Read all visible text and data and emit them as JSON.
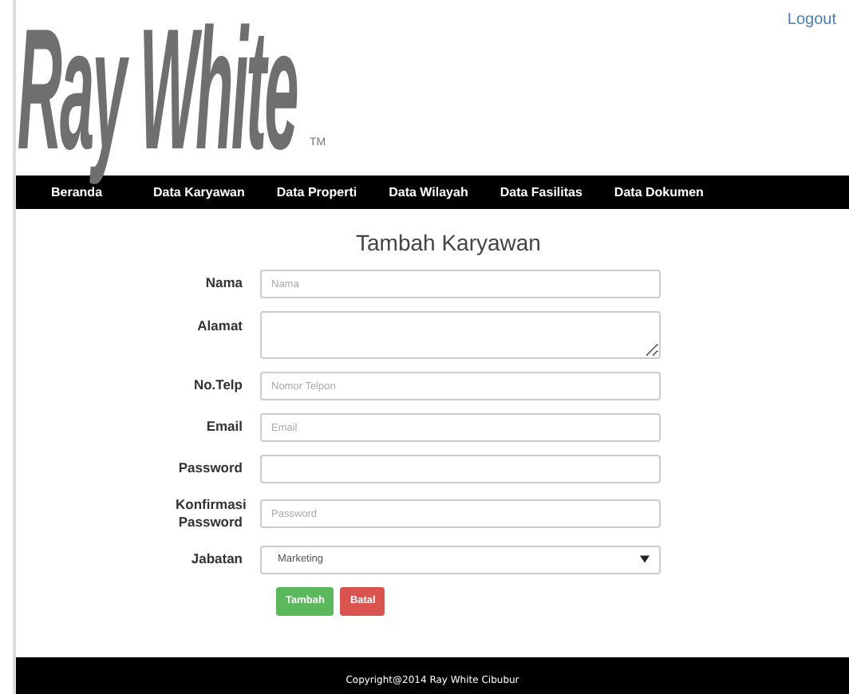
{
  "logo": {
    "name": "Ray White",
    "mark": "TM"
  },
  "logout": "Logout",
  "nav": [
    {
      "label": "Beranda"
    },
    {
      "label": "Data Karyawan"
    },
    {
      "label": "Data Properti"
    },
    {
      "label": "Data Wilayah"
    },
    {
      "label": "Data Fasilitas"
    },
    {
      "label": "Data Dokumen"
    }
  ],
  "title": "Tambah Karyawan",
  "fields": [
    {
      "kind": "input",
      "label": "Nama",
      "placeholder": "Nama"
    },
    {
      "kind": "textarea",
      "label": "Alamat"
    },
    {
      "kind": "input",
      "label": "No.Telp",
      "placeholder": "Nomor Telpon"
    },
    {
      "kind": "input",
      "label": "Email",
      "placeholder": "Email"
    },
    {
      "kind": "input",
      "label": "Password"
    },
    {
      "kind": "input",
      "label": "Konfirmasi Password",
      "placeholder": "Password"
    },
    {
      "kind": "select",
      "label": "Jabatan",
      "value": "Marketing"
    }
  ],
  "buttons": [
    {
      "label": "Tambah",
      "kind": "primary"
    },
    {
      "label": "Batal",
      "kind": "danger"
    }
  ],
  "footer": "Copyright@2014 Ray White Cibubur"
}
